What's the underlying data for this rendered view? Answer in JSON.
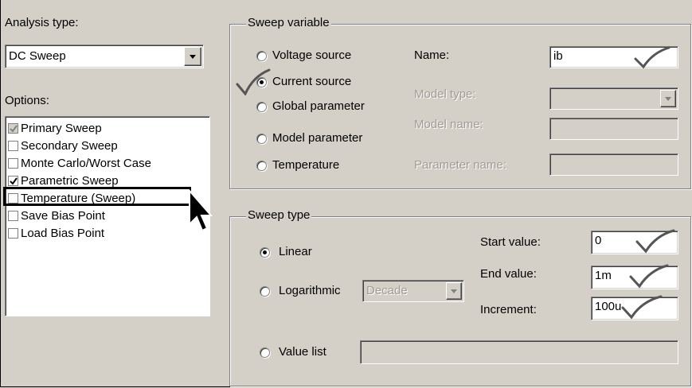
{
  "left": {
    "analysis_type_label": "Analysis type:",
    "analysis_type_value": "DC Sweep",
    "options_label": "Options:",
    "options": [
      {
        "label": "Primary Sweep",
        "checked": true,
        "grayed": true
      },
      {
        "label": "Secondary Sweep",
        "checked": false
      },
      {
        "label": "Monte Carlo/Worst Case",
        "checked": false
      },
      {
        "label": "Parametric Sweep",
        "checked": true
      },
      {
        "label": "Temperature (Sweep)",
        "checked": false
      },
      {
        "label": "Save Bias Point",
        "checked": false
      },
      {
        "label": "Load Bias Point",
        "checked": false
      }
    ]
  },
  "sweep_variable": {
    "title": "Sweep variable",
    "radios": [
      {
        "label": "Voltage source",
        "selected": false
      },
      {
        "label": "Current source",
        "selected": true
      },
      {
        "label": "Global parameter",
        "selected": false
      },
      {
        "label": "Model parameter",
        "selected": false
      },
      {
        "label": "Temperature",
        "selected": false
      }
    ],
    "name_label": "Name:",
    "name_value": "ib",
    "model_type_label": "Model type:",
    "model_name_label": "Model name:",
    "parameter_name_label": "Parameter name:"
  },
  "sweep_type": {
    "title": "Sweep type",
    "linear_label": "Linear",
    "log_label": "Logarithmic",
    "log_scale_value": "Decade",
    "value_list_label": "Value list",
    "start_label": "Start value:",
    "start_value": "0",
    "end_label": "End value:",
    "end_value": "1m",
    "increment_label": "Increment:",
    "increment_value": "100u"
  },
  "colors": {
    "dialog_bg": "#d4d0c8",
    "disabled_text": "#a09c94"
  }
}
